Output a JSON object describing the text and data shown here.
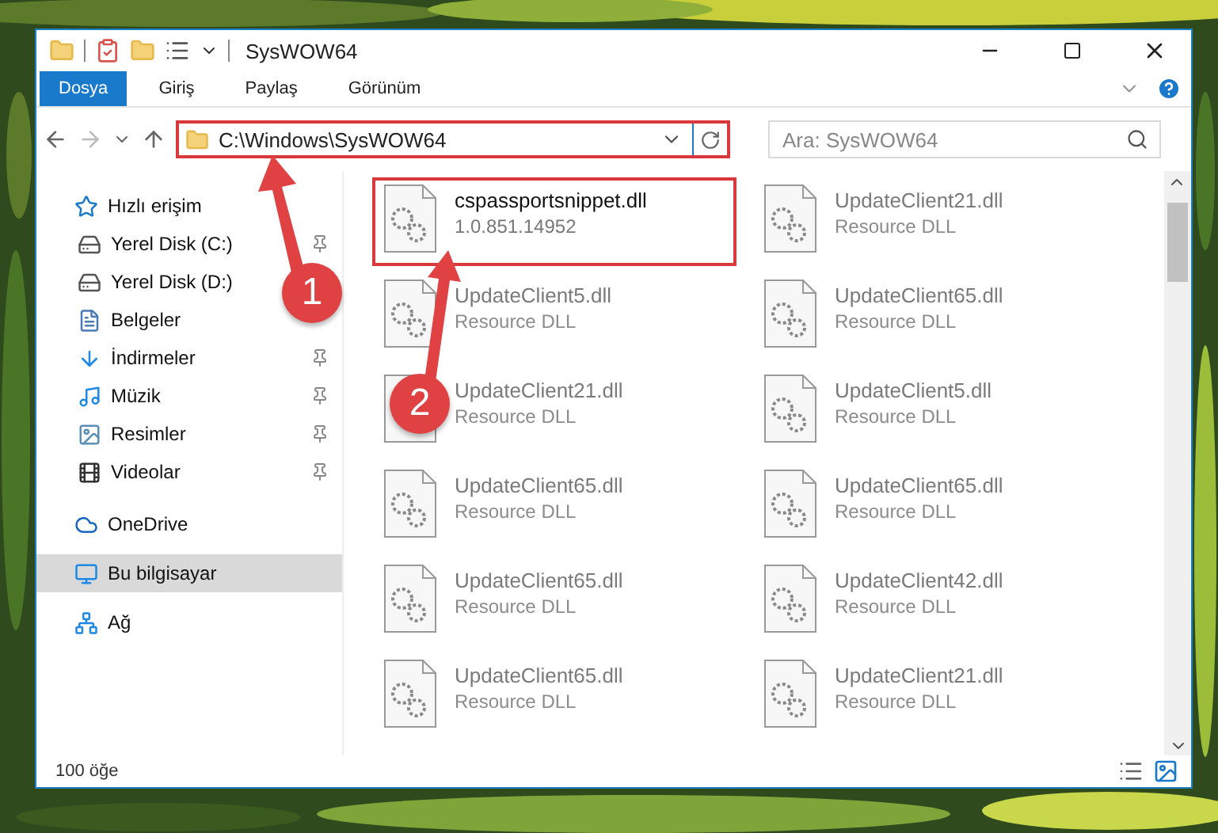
{
  "window": {
    "title": "SysWOW64"
  },
  "ribbon_tabs": [
    {
      "label": "Dosya",
      "selected": true
    },
    {
      "label": "Giriş",
      "selected": false
    },
    {
      "label": "Paylaş",
      "selected": false
    },
    {
      "label": "Görünüm",
      "selected": false
    }
  ],
  "address_bar": {
    "path": "C:\\Windows\\SysWOW64",
    "highlighted": true
  },
  "search": {
    "placeholder": "Ara: SysWOW64"
  },
  "sidebar": {
    "items": [
      {
        "label": "Hızlı erişim",
        "kind": "star",
        "selected": false,
        "children": [
          {
            "label": "Yerel Disk (C:)",
            "kind": "drive",
            "selected": false,
            "pinned": true
          },
          {
            "label": "Yerel Disk (D:)",
            "kind": "drive",
            "selected": false,
            "pinned": false
          },
          {
            "label": "Belgeler",
            "kind": "documents",
            "selected": false,
            "pinned": false
          },
          {
            "label": "İndirmeler",
            "kind": "downloads",
            "selected": false,
            "pinned": true
          },
          {
            "label": "Müzik",
            "kind": "music",
            "selected": false,
            "pinned": true
          },
          {
            "label": "Resimler",
            "kind": "pictures",
            "selected": false,
            "pinned": true
          },
          {
            "label": "Videolar",
            "kind": "videos",
            "selected": false,
            "pinned": true
          }
        ]
      },
      {
        "label": "OneDrive",
        "kind": "cloud",
        "selected": false
      },
      {
        "label": "Bu bilgisayar",
        "kind": "computer",
        "selected": true
      },
      {
        "label": "Ağ",
        "kind": "network",
        "selected": false
      }
    ]
  },
  "files": [
    {
      "name": "cspassportsnippet.dll",
      "detail": "1.0.851.14952",
      "highlighted": true,
      "blurred": false
    },
    {
      "name": "UpdateClient21.dll",
      "detail": "Resource DLL",
      "highlighted": false,
      "blurred": true
    },
    {
      "name": "UpdateClient5.dll",
      "detail": "Resource DLL",
      "highlighted": false,
      "blurred": true
    },
    {
      "name": "UpdateClient65.dll",
      "detail": "Resource DLL",
      "highlighted": false,
      "blurred": true
    },
    {
      "name": "UpdateClient21.dll",
      "detail": "Resource DLL",
      "highlighted": false,
      "blurred": true
    },
    {
      "name": "UpdateClient5.dll",
      "detail": "Resource DLL",
      "highlighted": false,
      "blurred": true
    },
    {
      "name": "UpdateClient65.dll",
      "detail": "Resource DLL",
      "highlighted": false,
      "blurred": true
    },
    {
      "name": "UpdateClient65.dll",
      "detail": "Resource DLL",
      "highlighted": false,
      "blurred": true
    },
    {
      "name": "UpdateClient65.dll",
      "detail": "Resource DLL",
      "highlighted": false,
      "blurred": true
    },
    {
      "name": "UpdateClient42.dll",
      "detail": "Resource DLL",
      "highlighted": false,
      "blurred": true
    },
    {
      "name": "UpdateClient65.dll",
      "detail": "Resource DLL",
      "highlighted": false,
      "blurred": true
    },
    {
      "name": "UpdateClient21.dll",
      "detail": "Resource DLL",
      "highlighted": false,
      "blurred": true
    }
  ],
  "status_bar": {
    "count": "100 öğe"
  },
  "annotations": [
    {
      "number": "1"
    },
    {
      "number": "2"
    }
  ]
}
